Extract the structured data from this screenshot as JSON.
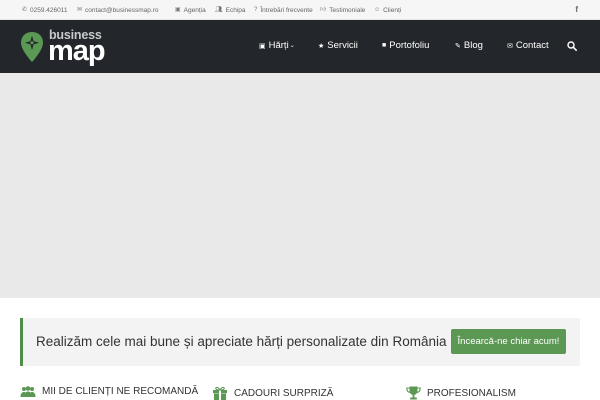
{
  "topbar": {
    "phone": "0259.426011",
    "email": "contact@businessmap.ro",
    "links": [
      "Agenția",
      "Echipa",
      "Întrebări frecvente",
      "Testimoniale",
      "Clienți"
    ],
    "social_icon": "f"
  },
  "logo": {
    "line1": "business",
    "line2": "map"
  },
  "nav": {
    "items": [
      {
        "label": "Hărți",
        "icon": "image-icon",
        "has_dropdown": true
      },
      {
        "label": "Servicii",
        "icon": "star-icon"
      },
      {
        "label": "Portofoliu",
        "icon": "briefcase-icon"
      },
      {
        "label": "Blog",
        "icon": "pencil-icon"
      },
      {
        "label": "Contact",
        "icon": "envelope-icon"
      }
    ],
    "search_icon": "search-icon"
  },
  "cta": {
    "text": "Realizăm cele mai bune și apreciate hărți personalizate din România",
    "button": "Încearcă-ne chiar acum!"
  },
  "features": [
    {
      "label": "MII DE CLIENȚI NE RECOMANDĂ",
      "icon": "users-icon"
    },
    {
      "label": "CADOURI SURPRIZĂ",
      "icon": "gift-icon"
    },
    {
      "label": "PROFESIONALISM",
      "icon": "trophy-icon"
    }
  ],
  "colors": {
    "brand_green": "#5b9854",
    "header_bg": "#23272b",
    "hero_bg": "#e9e9e9"
  }
}
